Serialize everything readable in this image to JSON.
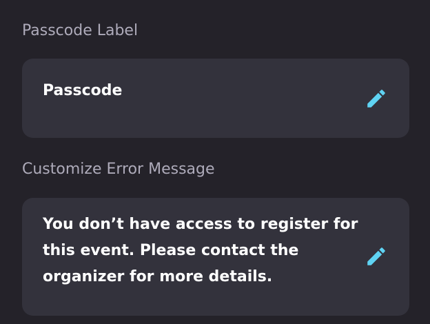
{
  "passcode_section": {
    "label": "Passcode Label",
    "value": "Passcode",
    "edit_icon": "pencil-edit-icon"
  },
  "error_section": {
    "label": "Customize Error Message",
    "value": "You don’t have access to register for this event. Please contact the organizer for more details.",
    "edit_icon": "pencil-edit-icon"
  },
  "colors": {
    "background": "#242229",
    "card": "#33323c",
    "label_text": "#aeabba",
    "value_text": "#ffffff",
    "accent": "#5fd3f3"
  }
}
